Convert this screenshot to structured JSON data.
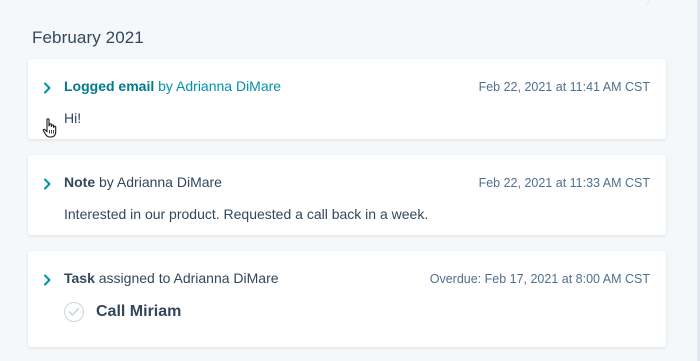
{
  "section": {
    "title": "February 2021"
  },
  "activities": [
    {
      "type": "Logged email",
      "by_text": " by Adrianna DiMare",
      "timestamp": "Feb 22, 2021 at 11:41 AM CST",
      "body": "Hi!"
    },
    {
      "type": "Note",
      "by_text": " by Adrianna DiMare",
      "timestamp": "Feb 22, 2021 at 11:33 AM CST",
      "body": "Interested in our product. Requested a call back in a week."
    },
    {
      "type": "Task",
      "by_text": " assigned to Adrianna DiMare",
      "timestamp": "Overdue: Feb 17, 2021 at 8:00 AM CST",
      "task_title": "Call Miriam"
    }
  ],
  "colors": {
    "background": "#f5f8fa",
    "card": "#ffffff",
    "text": "#33475b",
    "link_teal": "#007a8c",
    "link_blue": "#0091ae",
    "muted": "#516f90"
  },
  "icons": {
    "expand": "chevron-right-icon",
    "cursor": "hand-pointer-icon",
    "task_status": "check-circle-icon"
  }
}
